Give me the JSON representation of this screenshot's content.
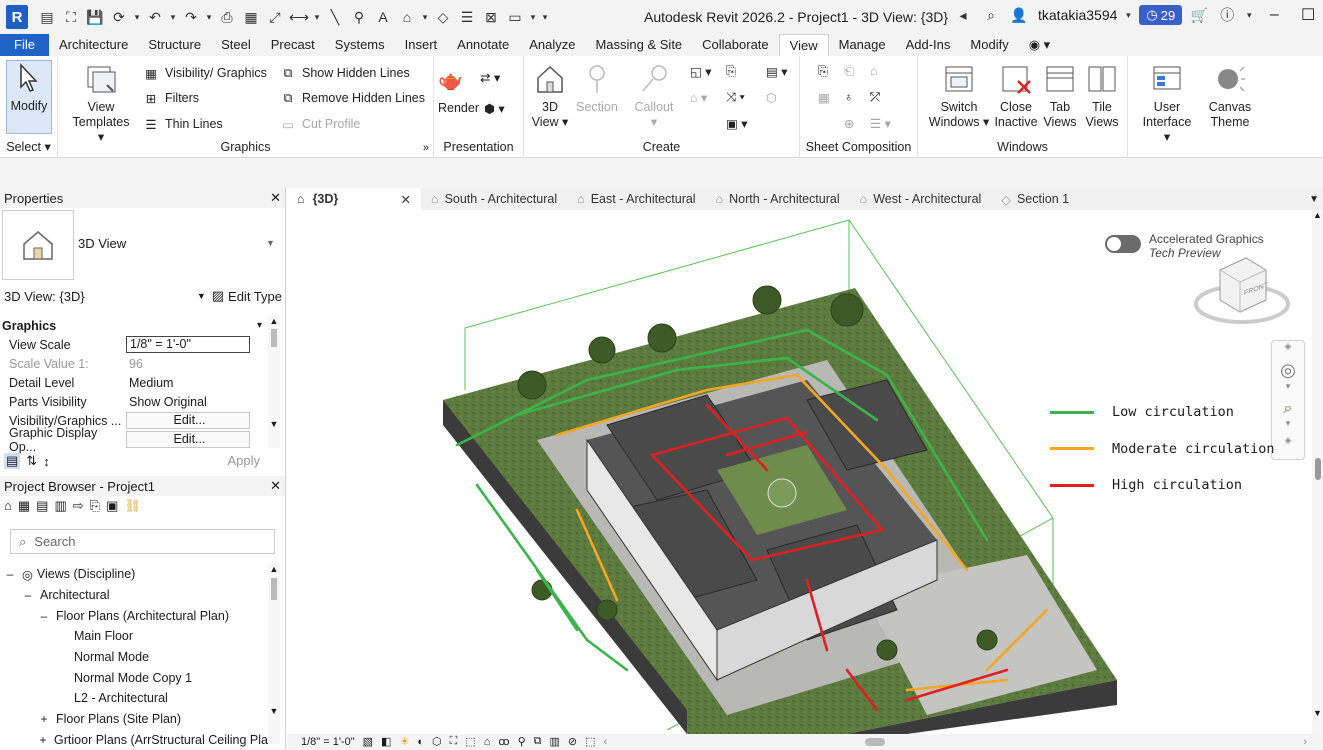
{
  "app": {
    "logo": "R",
    "title": "Autodesk Revit 2026.2 - Project1 - 3D View: {3D}",
    "username": "tkatakia3594",
    "notification_count": "29"
  },
  "menu": [
    "File",
    "Architecture",
    "Structure",
    "Steel",
    "Precast",
    "Systems",
    "Insert",
    "Annotate",
    "Analyze",
    "Massing & Site",
    "Collaborate",
    "View",
    "Manage",
    "Add-Ins",
    "Modify"
  ],
  "active_menu": "View",
  "ribbon": {
    "select": {
      "modify": "Modify",
      "title": "Select"
    },
    "graphics": {
      "view_templates_1": "View",
      "view_templates_2": "Templates",
      "visibility": "Visibility/ Graphics",
      "filters": "Filters",
      "thin_lines": "Thin Lines",
      "show_hidden": "Show Hidden Lines",
      "remove_hidden": "Remove Hidden Lines",
      "cut_profile": "Cut Profile",
      "title": "Graphics"
    },
    "presentation": {
      "render": "Render",
      "title": "Presentation"
    },
    "create": {
      "view3d_1": "3D",
      "view3d_2": "View",
      "section": "Section",
      "callout": "Callout",
      "title": "Create"
    },
    "sheet": {
      "title": "Sheet Composition"
    },
    "windows": {
      "switch_1": "Switch",
      "switch_2": "Windows",
      "close_1": "Close",
      "close_2": "Inactive",
      "tab_1": "Tab",
      "tab_2": "Views",
      "tile_1": "Tile",
      "tile_2": "Views",
      "title": "Windows"
    },
    "ui": {
      "user_1": "User",
      "user_2": "Interface",
      "canvas_1": "Canvas",
      "canvas_2": "Theme"
    }
  },
  "properties": {
    "title": "Properties",
    "type_name": "3D View",
    "selector": "3D View: {3D}",
    "edit_type": "Edit Type",
    "group": "Graphics",
    "rows": [
      {
        "k": "View Scale",
        "v": "1/8\" = 1'-0\""
      },
      {
        "k": "Scale Value    1:",
        "v": "96"
      },
      {
        "k": "Detail Level",
        "v": "Medium"
      },
      {
        "k": "Parts Visibility",
        "v": "Show Original"
      },
      {
        "k": "Visibility/Graphics ...",
        "v": "Edit..."
      },
      {
        "k": "Graphic Display Op...",
        "v": "Edit..."
      }
    ],
    "apply": "Apply"
  },
  "browser": {
    "title": "Project Browser - Project1",
    "search_placeholder": "Search",
    "tree": [
      "Views (Discipline)",
      "Architectural",
      "Floor Plans (Architectural Plan)",
      "Main Floor",
      "Normal Mode",
      "Normal Mode Copy 1",
      "L2 - Architectural",
      "Floor Plans (Site Plan)",
      "Grtioor Plans (ArrStructural Ceiling Pla"
    ]
  },
  "view_tabs": [
    "{3D}",
    "South - Architectural",
    "East - Architectural",
    "North - Architectural",
    "West - Architectural",
    "Section 1"
  ],
  "viewport": {
    "accel_1": "Accelerated Graphics",
    "accel_2": "Tech Preview",
    "viewcube_face": "FRONT",
    "legend": [
      {
        "label": "Low circulation",
        "color": "#3cb44b"
      },
      {
        "label": "Moderate circulation",
        "color": "#f5a623"
      },
      {
        "label": "High circulation",
        "color": "#e02020"
      }
    ],
    "scale": "1/8\" = 1'-0\""
  }
}
